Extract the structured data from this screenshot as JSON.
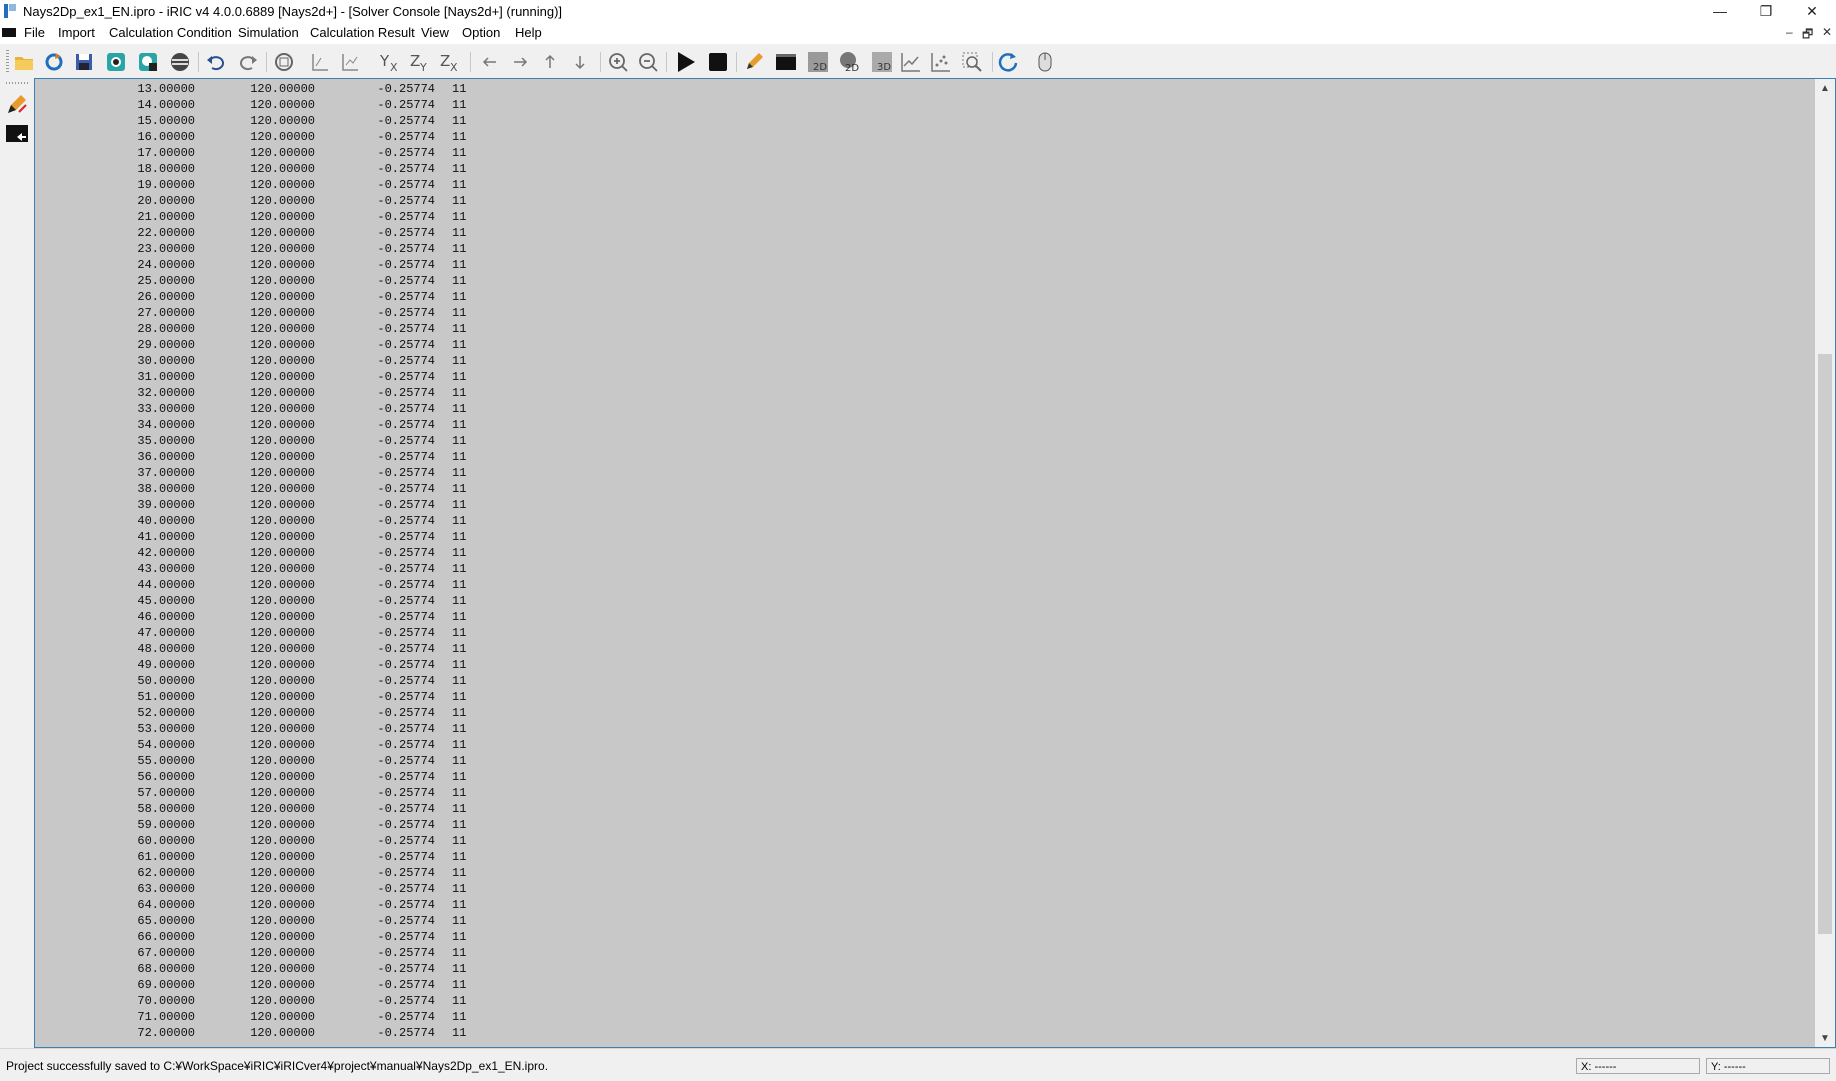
{
  "window": {
    "title": "Nays2Dp_ex1_EN.ipro - iRIC v4 4.0.0.6889 [Nays2d+] - [Solver Console [Nays2d+] (running)]",
    "minimize_glyph": "—",
    "maximize_glyph": "❐",
    "close_glyph": "✕"
  },
  "menubar": {
    "items": [
      "File",
      "Import",
      "Calculation Condition",
      "Simulation",
      "Calculation Result",
      "View",
      "Option",
      "Help"
    ],
    "mdi_min_glyph": "–",
    "mdi_restore_glyph": "🗗",
    "mdi_close_glyph": "✕"
  },
  "toolbar": {
    "icons": [
      "open-folder-icon",
      "reload-icon",
      "save-icon",
      "snapshot-icon",
      "snapshot-window-icon",
      "bird-eye-icon",
      "undo-icon",
      "redo-icon",
      "fit-view-icon",
      "reset-rotation-icon",
      "reset-zoom-icon",
      "xy-plane-icon",
      "zy-plane-icon",
      "zx-plane-icon",
      "move-left-icon",
      "move-right-icon",
      "move-up-icon",
      "move-down-icon",
      "zoom-in-icon",
      "zoom-out-icon",
      "run-icon",
      "stop-icon",
      "edit-icon",
      "console-icon",
      "2d-post-icon",
      "2d-bird-eye-icon",
      "3d-post-icon",
      "graph-icon",
      "scattered-graph-icon",
      "zoom-region-icon",
      "refresh-icon",
      "mouse-hint-icon"
    ],
    "accent_color": "#1e6fbd"
  },
  "left_dock": {
    "icons": [
      "pre-processor-icon",
      "solver-console-icon"
    ]
  },
  "console": {
    "background": "#c8c8c8",
    "lines": [
      {
        "x": "13.00000",
        "y": "120.00000",
        "z": "-0.25774",
        "n": "11"
      },
      {
        "x": "14.00000",
        "y": "120.00000",
        "z": "-0.25774",
        "n": "11"
      },
      {
        "x": "15.00000",
        "y": "120.00000",
        "z": "-0.25774",
        "n": "11"
      },
      {
        "x": "16.00000",
        "y": "120.00000",
        "z": "-0.25774",
        "n": "11"
      },
      {
        "x": "17.00000",
        "y": "120.00000",
        "z": "-0.25774",
        "n": "11"
      },
      {
        "x": "18.00000",
        "y": "120.00000",
        "z": "-0.25774",
        "n": "11"
      },
      {
        "x": "19.00000",
        "y": "120.00000",
        "z": "-0.25774",
        "n": "11"
      },
      {
        "x": "20.00000",
        "y": "120.00000",
        "z": "-0.25774",
        "n": "11"
      },
      {
        "x": "21.00000",
        "y": "120.00000",
        "z": "-0.25774",
        "n": "11"
      },
      {
        "x": "22.00000",
        "y": "120.00000",
        "z": "-0.25774",
        "n": "11"
      },
      {
        "x": "23.00000",
        "y": "120.00000",
        "z": "-0.25774",
        "n": "11"
      },
      {
        "x": "24.00000",
        "y": "120.00000",
        "z": "-0.25774",
        "n": "11"
      },
      {
        "x": "25.00000",
        "y": "120.00000",
        "z": "-0.25774",
        "n": "11"
      },
      {
        "x": "26.00000",
        "y": "120.00000",
        "z": "-0.25774",
        "n": "11"
      },
      {
        "x": "27.00000",
        "y": "120.00000",
        "z": "-0.25774",
        "n": "11"
      },
      {
        "x": "28.00000",
        "y": "120.00000",
        "z": "-0.25774",
        "n": "11"
      },
      {
        "x": "29.00000",
        "y": "120.00000",
        "z": "-0.25774",
        "n": "11"
      },
      {
        "x": "30.00000",
        "y": "120.00000",
        "z": "-0.25774",
        "n": "11"
      },
      {
        "x": "31.00000",
        "y": "120.00000",
        "z": "-0.25774",
        "n": "11"
      },
      {
        "x": "32.00000",
        "y": "120.00000",
        "z": "-0.25774",
        "n": "11"
      },
      {
        "x": "33.00000",
        "y": "120.00000",
        "z": "-0.25774",
        "n": "11"
      },
      {
        "x": "34.00000",
        "y": "120.00000",
        "z": "-0.25774",
        "n": "11"
      },
      {
        "x": "35.00000",
        "y": "120.00000",
        "z": "-0.25774",
        "n": "11"
      },
      {
        "x": "36.00000",
        "y": "120.00000",
        "z": "-0.25774",
        "n": "11"
      },
      {
        "x": "37.00000",
        "y": "120.00000",
        "z": "-0.25774",
        "n": "11"
      },
      {
        "x": "38.00000",
        "y": "120.00000",
        "z": "-0.25774",
        "n": "11"
      },
      {
        "x": "39.00000",
        "y": "120.00000",
        "z": "-0.25774",
        "n": "11"
      },
      {
        "x": "40.00000",
        "y": "120.00000",
        "z": "-0.25774",
        "n": "11"
      },
      {
        "x": "41.00000",
        "y": "120.00000",
        "z": "-0.25774",
        "n": "11"
      },
      {
        "x": "42.00000",
        "y": "120.00000",
        "z": "-0.25774",
        "n": "11"
      },
      {
        "x": "43.00000",
        "y": "120.00000",
        "z": "-0.25774",
        "n": "11"
      },
      {
        "x": "44.00000",
        "y": "120.00000",
        "z": "-0.25774",
        "n": "11"
      },
      {
        "x": "45.00000",
        "y": "120.00000",
        "z": "-0.25774",
        "n": "11"
      },
      {
        "x": "46.00000",
        "y": "120.00000",
        "z": "-0.25774",
        "n": "11"
      },
      {
        "x": "47.00000",
        "y": "120.00000",
        "z": "-0.25774",
        "n": "11"
      },
      {
        "x": "48.00000",
        "y": "120.00000",
        "z": "-0.25774",
        "n": "11"
      },
      {
        "x": "49.00000",
        "y": "120.00000",
        "z": "-0.25774",
        "n": "11"
      },
      {
        "x": "50.00000",
        "y": "120.00000",
        "z": "-0.25774",
        "n": "11"
      },
      {
        "x": "51.00000",
        "y": "120.00000",
        "z": "-0.25774",
        "n": "11"
      },
      {
        "x": "52.00000",
        "y": "120.00000",
        "z": "-0.25774",
        "n": "11"
      },
      {
        "x": "53.00000",
        "y": "120.00000",
        "z": "-0.25774",
        "n": "11"
      },
      {
        "x": "54.00000",
        "y": "120.00000",
        "z": "-0.25774",
        "n": "11"
      },
      {
        "x": "55.00000",
        "y": "120.00000",
        "z": "-0.25774",
        "n": "11"
      },
      {
        "x": "56.00000",
        "y": "120.00000",
        "z": "-0.25774",
        "n": "11"
      },
      {
        "x": "57.00000",
        "y": "120.00000",
        "z": "-0.25774",
        "n": "11"
      },
      {
        "x": "58.00000",
        "y": "120.00000",
        "z": "-0.25774",
        "n": "11"
      },
      {
        "x": "59.00000",
        "y": "120.00000",
        "z": "-0.25774",
        "n": "11"
      },
      {
        "x": "60.00000",
        "y": "120.00000",
        "z": "-0.25774",
        "n": "11"
      },
      {
        "x": "61.00000",
        "y": "120.00000",
        "z": "-0.25774",
        "n": "11"
      },
      {
        "x": "62.00000",
        "y": "120.00000",
        "z": "-0.25774",
        "n": "11"
      },
      {
        "x": "63.00000",
        "y": "120.00000",
        "z": "-0.25774",
        "n": "11"
      },
      {
        "x": "64.00000",
        "y": "120.00000",
        "z": "-0.25774",
        "n": "11"
      },
      {
        "x": "65.00000",
        "y": "120.00000",
        "z": "-0.25774",
        "n": "11"
      },
      {
        "x": "66.00000",
        "y": "120.00000",
        "z": "-0.25774",
        "n": "11"
      },
      {
        "x": "67.00000",
        "y": "120.00000",
        "z": "-0.25774",
        "n": "11"
      },
      {
        "x": "68.00000",
        "y": "120.00000",
        "z": "-0.25774",
        "n": "11"
      },
      {
        "x": "69.00000",
        "y": "120.00000",
        "z": "-0.25774",
        "n": "11"
      },
      {
        "x": "70.00000",
        "y": "120.00000",
        "z": "-0.25774",
        "n": "11"
      },
      {
        "x": "71.00000",
        "y": "120.00000",
        "z": "-0.25774",
        "n": "11"
      },
      {
        "x": "72.00000",
        "y": "120.00000",
        "z": "-0.25774",
        "n": "11"
      }
    ],
    "scrollbar": {
      "up_glyph": "▲",
      "down_glyph": "▼",
      "position_fraction": 0.73
    }
  },
  "statusbar": {
    "message": "Project successfully saved to C:¥WorkSpace¥iRIC¥iRICver4¥project¥manual¥Nays2Dp_ex1_EN.ipro.",
    "x_readout": "X: ------",
    "y_readout": "Y: ------"
  }
}
